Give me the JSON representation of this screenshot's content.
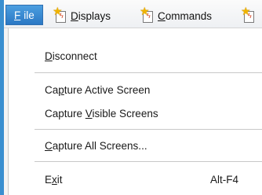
{
  "menubar": {
    "file": {
      "prefix": "",
      "key": "F",
      "rest": "ile"
    },
    "displays": {
      "key": "D",
      "rest": "isplays"
    },
    "commands": {
      "key": "C",
      "rest": "ommands"
    }
  },
  "menu": {
    "disconnect": {
      "key": "D",
      "rest": "isconnect"
    },
    "capture_active": {
      "before": "Ca",
      "key": "p",
      "rest": "ture Active Screen"
    },
    "capture_visible": {
      "before": "Capture ",
      "key": "V",
      "rest": "isible Screens"
    },
    "capture_all": {
      "key": "C",
      "rest": "apture All Screens..."
    },
    "exit": {
      "before": "E",
      "key": "x",
      "rest": "it",
      "shortcut": "Alt-F4"
    }
  },
  "colors": {
    "accent": "#2b78c4",
    "icon_star": "#f0b400"
  },
  "icons": [
    "document-star-icon"
  ]
}
